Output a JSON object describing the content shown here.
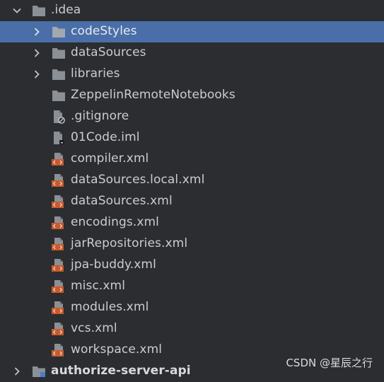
{
  "tree": {
    "items": [
      {
        "label": ".idea",
        "icon": "folder-icon",
        "expander": "chevron-down-icon"
      },
      {
        "label": "codeStyles",
        "icon": "folder-icon",
        "expander": "chevron-right-icon",
        "selected": true
      },
      {
        "label": "dataSources",
        "icon": "folder-icon",
        "expander": "chevron-right-icon"
      },
      {
        "label": "libraries",
        "icon": "folder-icon",
        "expander": "chevron-right-icon"
      },
      {
        "label": "ZeppelinRemoteNotebooks",
        "icon": "folder-icon"
      },
      {
        "label": ".gitignore",
        "icon": "ignore-file-icon"
      },
      {
        "label": "01Code.iml",
        "icon": "iml-file-icon"
      },
      {
        "label": "compiler.xml",
        "icon": "xml-file-icon"
      },
      {
        "label": "dataSources.local.xml",
        "icon": "xml-file-icon"
      },
      {
        "label": "dataSources.xml",
        "icon": "xml-file-icon"
      },
      {
        "label": "encodings.xml",
        "icon": "xml-file-icon"
      },
      {
        "label": "jarRepositories.xml",
        "icon": "xml-file-icon"
      },
      {
        "label": "jpa-buddy.xml",
        "icon": "xml-file-icon"
      },
      {
        "label": "misc.xml",
        "icon": "xml-file-icon"
      },
      {
        "label": "modules.xml",
        "icon": "xml-file-icon"
      },
      {
        "label": "vcs.xml",
        "icon": "xml-file-icon"
      },
      {
        "label": "workspace.xml",
        "icon": "xml-file-icon"
      },
      {
        "label": "authorize-server-api",
        "icon": "module-folder-icon",
        "expander": "chevron-right-icon"
      }
    ]
  },
  "watermark": "CSDN @星辰之行",
  "colors": {
    "background": "#2b2d30",
    "selection": "#4a6ea8",
    "folder": "#8b9097",
    "xml_badge": "#c75b2e"
  }
}
